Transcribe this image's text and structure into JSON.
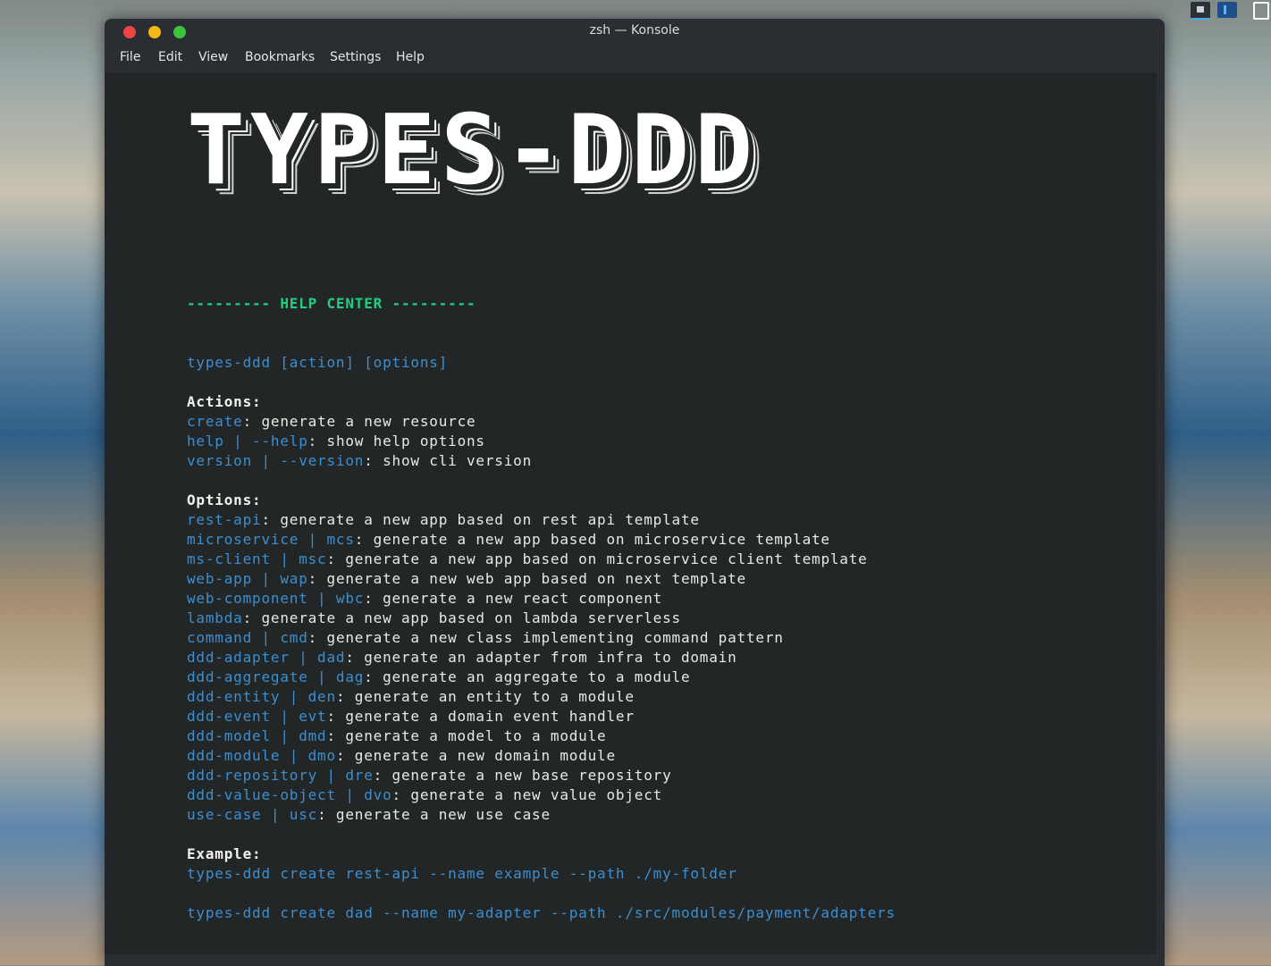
{
  "window": {
    "title": "zsh — Konsole",
    "menu": [
      "File",
      "Edit",
      "View",
      "Bookmarks",
      "Settings",
      "Help"
    ]
  },
  "terminal": {
    "banner": "TYPES-DDD",
    "help_center": "--------- HELP CENTER ---------",
    "usage": "types-ddd [action] [options]",
    "actions_heading": "Actions:",
    "actions": [
      {
        "cmd": "create",
        "desc": ": generate a new resource"
      },
      {
        "cmd": "help | --help",
        "desc": ": show help options"
      },
      {
        "cmd": "version | --version",
        "desc": ": show cli version"
      }
    ],
    "options_heading": "Options:",
    "options": [
      {
        "cmd": "rest-api",
        "desc": ": generate a new app based on rest api template"
      },
      {
        "cmd": "microservice | mcs",
        "desc": ": generate a new app based on microservice template"
      },
      {
        "cmd": "ms-client | msc",
        "desc": ": generate a new app based on microservice client template"
      },
      {
        "cmd": "web-app | wap",
        "desc": ": generate a new web app based on next template"
      },
      {
        "cmd": "web-component | wbc",
        "desc": ": generate a new react component"
      },
      {
        "cmd": "lambda",
        "desc": ": generate a new app based on lambda serverless"
      },
      {
        "cmd": "command | cmd",
        "desc": ": generate a new class implementing command pattern"
      },
      {
        "cmd": "ddd-adapter | dad",
        "desc": ": generate an adapter from infra to domain"
      },
      {
        "cmd": "ddd-aggregate | dag",
        "desc": ": generate an aggregate to a module"
      },
      {
        "cmd": "ddd-entity | den",
        "desc": ": generate an entity to a module"
      },
      {
        "cmd": "ddd-event | evt",
        "desc": ": generate a domain event handler"
      },
      {
        "cmd": "ddd-model | dmd",
        "desc": ": generate a model to a module"
      },
      {
        "cmd": "ddd-module | dmo",
        "desc": ": generate a new domain module"
      },
      {
        "cmd": "ddd-repository | dre",
        "desc": ": generate a new base repository"
      },
      {
        "cmd": "ddd-value-object | dvo",
        "desc": ": generate a new value object"
      },
      {
        "cmd": "use-case | usc",
        "desc": ": generate a new use case"
      }
    ],
    "example_heading": "Example:",
    "examples": [
      "types-ddd create rest-api --name example --path ./my-folder",
      "types-ddd create dad --name my-adapter --path ./src/modules/payment/adapters"
    ]
  },
  "colors": {
    "terminal_bg": "#232627",
    "command_blue": "#3b8fd1",
    "heading_green": "#1fcf7f",
    "text_white": "#e8e8e8"
  }
}
